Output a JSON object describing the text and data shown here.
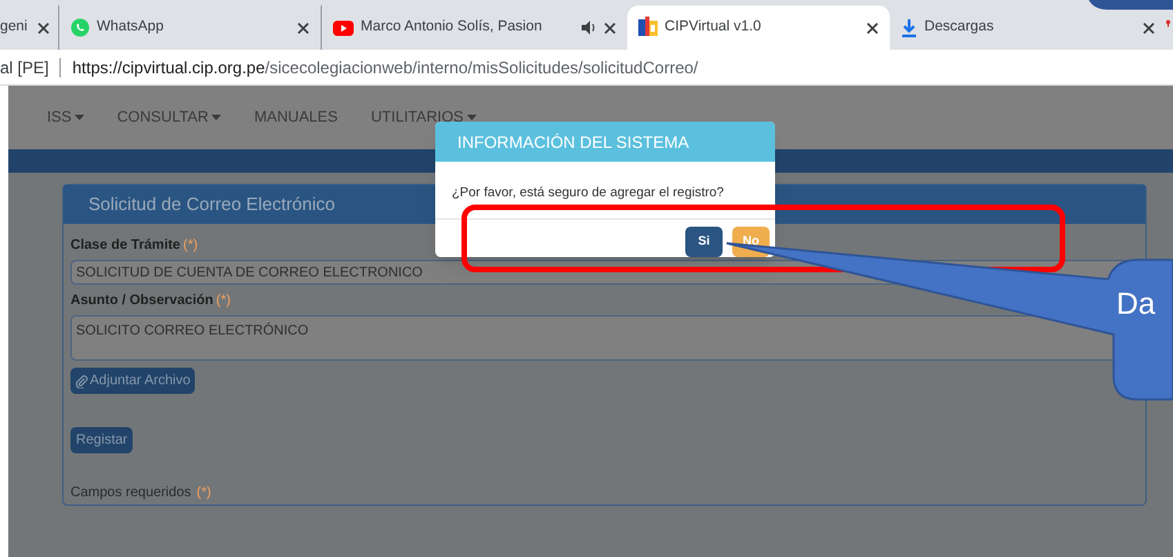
{
  "browser_tabs": [
    {
      "title": "geni",
      "kind": "plain",
      "audio": false,
      "selected": false
    },
    {
      "title": "WhatsApp",
      "kind": "chat",
      "audio": false,
      "selected": false
    },
    {
      "title": "Marco Antonio Solís, Pasion",
      "kind": "video",
      "audio": true,
      "selected": false
    },
    {
      "title": "CIPVirtual v1.0",
      "kind": "site",
      "audio": false,
      "selected": true
    },
    {
      "title": "Descargas",
      "kind": "download",
      "audio": false,
      "selected": false
    }
  ],
  "address_bar": {
    "site_label": "al [PE]",
    "url_host": "https://cipvirtual.cip.org.pe",
    "url_path": "/sicecolegiacionweb/interno/misSolicitudes/solicitudCorreo/"
  },
  "nav_menu": [
    {
      "label": "ISS",
      "has_menu": true
    },
    {
      "label": "CONSULTAR",
      "has_menu": true
    },
    {
      "label": "MANUALES",
      "has_menu": false
    },
    {
      "label": "UTILITARIOS",
      "has_menu": true
    }
  ],
  "form_panel": {
    "title": "Solicitud de Correo Electrónico",
    "fields": [
      {
        "label": "Clase de Trámite",
        "required_mark": "(*)",
        "value": "SOLICITUD DE CUENTA DE CORREO ELECTRONICO",
        "kind": "select"
      },
      {
        "label": "Asunto / Observación",
        "required_mark": "(*)",
        "value": "SOLICITO CORREO ELECTRÓNICO",
        "kind": "textarea"
      }
    ],
    "attach_button": "Adjuntar Archivo",
    "submit_button": "Registar",
    "footer_note": "Campos requeridos",
    "footer_mark": "(*)"
  },
  "dialog": {
    "title": "INFORMACIÓN DEL SISTEMA",
    "message": "¿Por favor, está seguro de agregar el registro?",
    "buttons": [
      {
        "label": "Si",
        "kind": "primary"
      },
      {
        "label": "No",
        "kind": "warning"
      }
    ]
  },
  "callout": {
    "text": "Da"
  }
}
